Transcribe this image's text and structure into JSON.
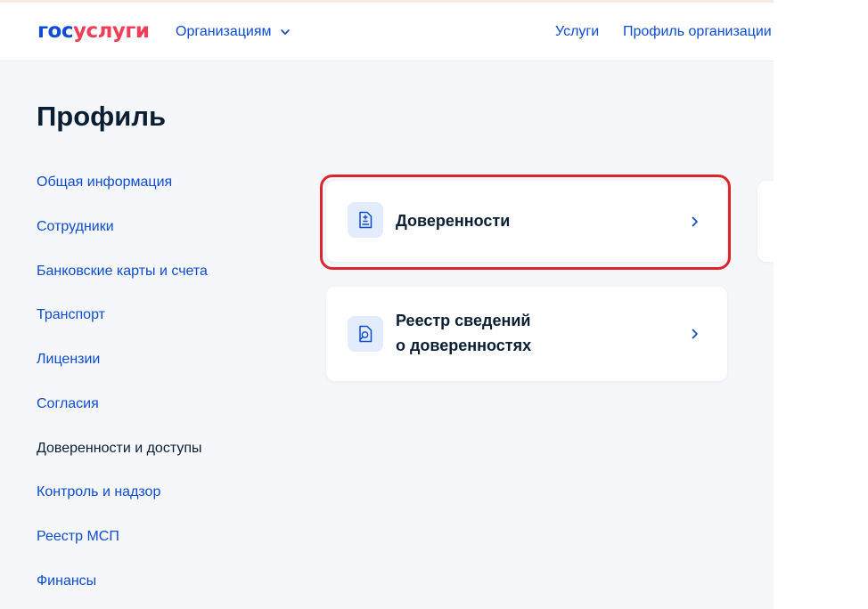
{
  "header": {
    "logo_part1": "гос",
    "logo_part2": "услуги",
    "org_menu_label": "Организациям",
    "nav": {
      "services": "Услуги",
      "org_profile": "Профиль организации"
    }
  },
  "page": {
    "title": "Профиль"
  },
  "sidebar": {
    "items": [
      {
        "label": "Общая информация"
      },
      {
        "label": "Сотрудники"
      },
      {
        "label": "Банковские карты и счета"
      },
      {
        "label": "Транспорт"
      },
      {
        "label": "Лицензии"
      },
      {
        "label": "Согласия"
      },
      {
        "label": "Доверенности и доступы"
      },
      {
        "label": "Контроль и надзор"
      },
      {
        "label": "Реестр МСП"
      },
      {
        "label": "Финансы"
      }
    ],
    "active_index": 6
  },
  "cards": [
    {
      "title": "Доверенности",
      "icon": "document-plus-minus-icon"
    },
    {
      "title_line1": "Реестр сведений",
      "title_line2": "о доверенностях",
      "icon": "document-search-icon"
    }
  ],
  "colors": {
    "brand_blue": "#0d4cd3",
    "brand_red": "#ee3f58",
    "text_dark": "#0b1f33",
    "highlight": "#e0242c",
    "icon_bg": "#e3ecfb"
  }
}
